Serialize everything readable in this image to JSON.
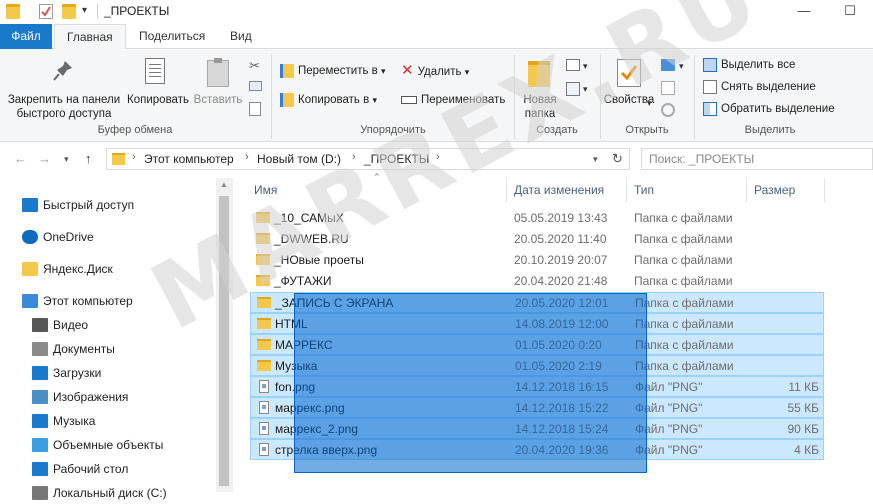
{
  "window": {
    "title": "_ПРОЕКТЫ",
    "minimize": "—",
    "maximize": "☐"
  },
  "tabs": [
    "Файл",
    "Главная",
    "Поделиться",
    "Вид"
  ],
  "ribbon": {
    "clipboard": {
      "pin_label_1": "Закрепить на панели",
      "pin_label_2": "быстрого доступа",
      "copy": "Копировать",
      "paste": "Вставить",
      "group": "Буфер обмена"
    },
    "organize": {
      "move": "Переместить в",
      "copy_to": "Копировать в",
      "delete": "Удалить",
      "rename": "Переименовать",
      "group": "Упорядочить"
    },
    "new": {
      "new_folder_1": "Новая",
      "new_folder_2": "папка",
      "group": "Создать"
    },
    "open": {
      "properties": "Свойства",
      "group": "Открыть"
    },
    "select": {
      "select_all": "Выделить все",
      "select_none": "Снять выделение",
      "invert": "Обратить выделение",
      "group": "Выделить"
    }
  },
  "address": {
    "crumbs": [
      "Этот компьютер",
      "Новый том (D:)",
      "_ПРОЕКТЫ"
    ],
    "search_placeholder": "Поиск: _ПРОЕКТЫ"
  },
  "nav_pane": [
    {
      "label": "Быстрый доступ",
      "icon": "star-icon",
      "color": "#1979ca"
    },
    {
      "label": "OneDrive",
      "icon": "cloud-icon",
      "color": "#0f6cbd"
    },
    {
      "label": "Яндекс.Диск",
      "icon": "folder-icon",
      "color": "#f3c84b"
    },
    {
      "label": "Этот компьютер",
      "icon": "computer-icon",
      "color": "#3a8ad8"
    },
    {
      "label": "Видео",
      "icon": "video-icon",
      "color": "#555555"
    },
    {
      "label": "Документы",
      "icon": "documents-icon",
      "color": "#8a8a8a"
    },
    {
      "label": "Загрузки",
      "icon": "download-icon",
      "color": "#1979ca"
    },
    {
      "label": "Изображения",
      "icon": "pictures-icon",
      "color": "#4a90c2"
    },
    {
      "label": "Музыка",
      "icon": "music-icon",
      "color": "#1979ca"
    },
    {
      "label": "Объемные объекты",
      "icon": "3d-objects-icon",
      "color": "#38a0e0"
    },
    {
      "label": "Рабочий стол",
      "icon": "desktop-icon",
      "color": "#1979ca"
    },
    {
      "label": "Локальный диск (C:)",
      "icon": "drive-icon",
      "color": "#777777"
    }
  ],
  "columns": {
    "name": "Имя",
    "date": "Дата изменения",
    "type": "Тип",
    "size": "Размер"
  },
  "files": [
    {
      "name": "_10_САМыХ",
      "date": "05.05.2019 13:43",
      "type": "Папка с файлами",
      "size": "",
      "kind": "folder",
      "selected": false
    },
    {
      "name": "_DWWEB.RU",
      "date": "20.05.2020 11:40",
      "type": "Папка с файлами",
      "size": "",
      "kind": "folder",
      "selected": false
    },
    {
      "name": "_НОвые проеты",
      "date": "20.10.2019 20:07",
      "type": "Папка с файлами",
      "size": "",
      "kind": "folder",
      "selected": false
    },
    {
      "name": "_ФУТАЖИ",
      "date": "20.04.2020 21:48",
      "type": "Папка с файлами",
      "size": "",
      "kind": "folder",
      "selected": false
    },
    {
      "name": "_ЗАПИСЬ С ЭКРАНА",
      "date": "20.05.2020 12:01",
      "type": "Папка с файлами",
      "size": "",
      "kind": "folder",
      "selected": true
    },
    {
      "name": "HTML",
      "date": "14.08.2019 12:00",
      "type": "Папка с файлами",
      "size": "",
      "kind": "folder",
      "selected": true
    },
    {
      "name": "МАРРЕКС",
      "date": "01.05.2020 0:20",
      "type": "Папка с файлами",
      "size": "",
      "kind": "folder",
      "selected": true
    },
    {
      "name": "Музыка",
      "date": "01.05.2020 2:19",
      "type": "Папка с файлами",
      "size": "",
      "kind": "folder",
      "selected": true
    },
    {
      "name": "fon.png",
      "date": "14.12.2018 16:15",
      "type": "Файл \"PNG\"",
      "size": "11 КБ",
      "kind": "png",
      "selected": true
    },
    {
      "name": "маррекс.png",
      "date": "14.12.2018 15:22",
      "type": "Файл \"PNG\"",
      "size": "55 КБ",
      "kind": "png",
      "selected": true
    },
    {
      "name": "маррекс_2.png",
      "date": "14.12.2018 15:24",
      "type": "Файл \"PNG\"",
      "size": "90 КБ",
      "kind": "png",
      "selected": true
    },
    {
      "name": "стрелка вверх.png",
      "date": "20.04.2020 19:36",
      "type": "Файл \"PNG\"",
      "size": "4 КБ",
      "kind": "png",
      "selected": true
    }
  ],
  "watermark": "MARREX.RU"
}
